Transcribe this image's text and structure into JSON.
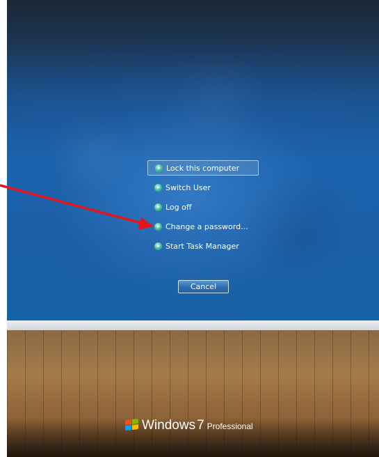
{
  "security_screen": {
    "menu": [
      {
        "label": "Lock this computer",
        "selected": true
      },
      {
        "label": "Switch User",
        "selected": false
      },
      {
        "label": "Log off",
        "selected": false
      },
      {
        "label": "Change a password...",
        "selected": false
      },
      {
        "label": "Start Task Manager",
        "selected": false
      }
    ],
    "cancel_label": "Cancel"
  },
  "branding": {
    "name": "Windows",
    "version": "7",
    "edition": "Professional"
  },
  "colors": {
    "annotation_arrow": "#e8141c",
    "menu_icon": "#3fbe98",
    "background_blue": "#1b63ad"
  }
}
